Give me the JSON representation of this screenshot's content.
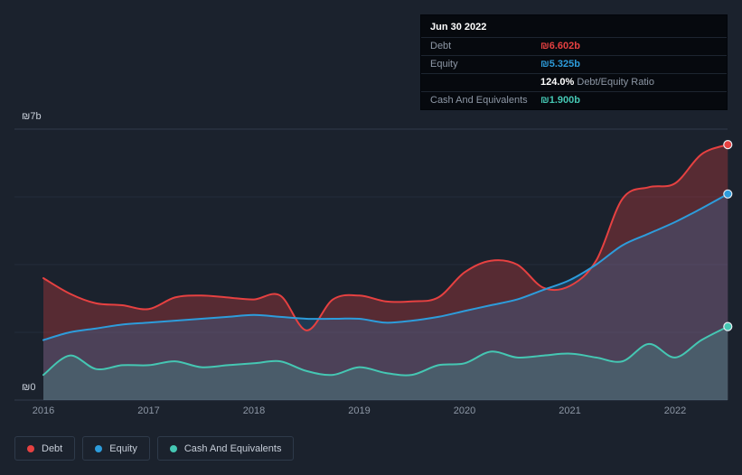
{
  "colors": {
    "background": "#1b222d",
    "debt": "#e64141",
    "equity": "#2d9cdb",
    "cash": "#45c7b3",
    "grid_strong": "#303b4c",
    "grid_faint": "#232c3a",
    "axis_text": "#8d97a5",
    "tooltip_bg": "#06090e"
  },
  "tooltip": {
    "date": "Jun 30 2022",
    "debt_label": "Debt",
    "debt_value": "₪6.602b",
    "equity_label": "Equity",
    "equity_value": "₪5.325b",
    "ratio_value": "124.0%",
    "ratio_label": "Debt/Equity Ratio",
    "cash_label": "Cash And Equivalents",
    "cash_value": "₪1.900b"
  },
  "chart_data": {
    "type": "area",
    "title": "",
    "xlabel": "",
    "ylabel": "",
    "ylim": [
      0,
      7
    ],
    "currency": "₪",
    "y_tick_labels": [
      "₪7b",
      "₪0"
    ],
    "x_tick_labels": [
      "2016",
      "2017",
      "2018",
      "2019",
      "2020",
      "2021",
      "2022"
    ],
    "grid": true,
    "legend_position": "bottom-left",
    "x": [
      2016,
      2016.25,
      2016.5,
      2016.75,
      2017,
      2017.25,
      2017.5,
      2017.75,
      2018,
      2018.25,
      2018.5,
      2018.75,
      2019,
      2019.25,
      2019.5,
      2019.75,
      2020,
      2020.25,
      2020.5,
      2020.75,
      2021,
      2021.25,
      2021.5,
      2021.75,
      2022,
      2022.25,
      2022.5
    ],
    "series": [
      {
        "name": "Debt",
        "color": "#e64141",
        "fill": "rgba(230,65,65,0.30)",
        "values": [
          3.15,
          2.75,
          2.5,
          2.45,
          2.35,
          2.65,
          2.7,
          2.65,
          2.6,
          2.7,
          1.8,
          2.6,
          2.7,
          2.55,
          2.55,
          2.65,
          3.3,
          3.6,
          3.5,
          2.9,
          2.95,
          3.6,
          5.2,
          5.5,
          5.6,
          6.35,
          6.602
        ]
      },
      {
        "name": "Equity",
        "color": "#2d9cdb",
        "fill": "rgba(45,130,200,0.25)",
        "values": [
          1.55,
          1.75,
          1.85,
          1.95,
          2.0,
          2.05,
          2.1,
          2.15,
          2.2,
          2.15,
          2.1,
          2.1,
          2.1,
          2.0,
          2.05,
          2.15,
          2.3,
          2.45,
          2.6,
          2.85,
          3.1,
          3.5,
          4.0,
          4.3,
          4.6,
          4.95,
          5.325
        ]
      },
      {
        "name": "Cash And Equivalents",
        "color": "#45c7b3",
        "fill": "rgba(69,199,179,0.20)",
        "values": [
          0.65,
          1.15,
          0.8,
          0.9,
          0.9,
          1.0,
          0.85,
          0.9,
          0.95,
          1.0,
          0.75,
          0.65,
          0.85,
          0.7,
          0.65,
          0.9,
          0.95,
          1.25,
          1.1,
          1.15,
          1.2,
          1.1,
          1.0,
          1.45,
          1.1,
          1.55,
          1.9
        ]
      }
    ]
  }
}
